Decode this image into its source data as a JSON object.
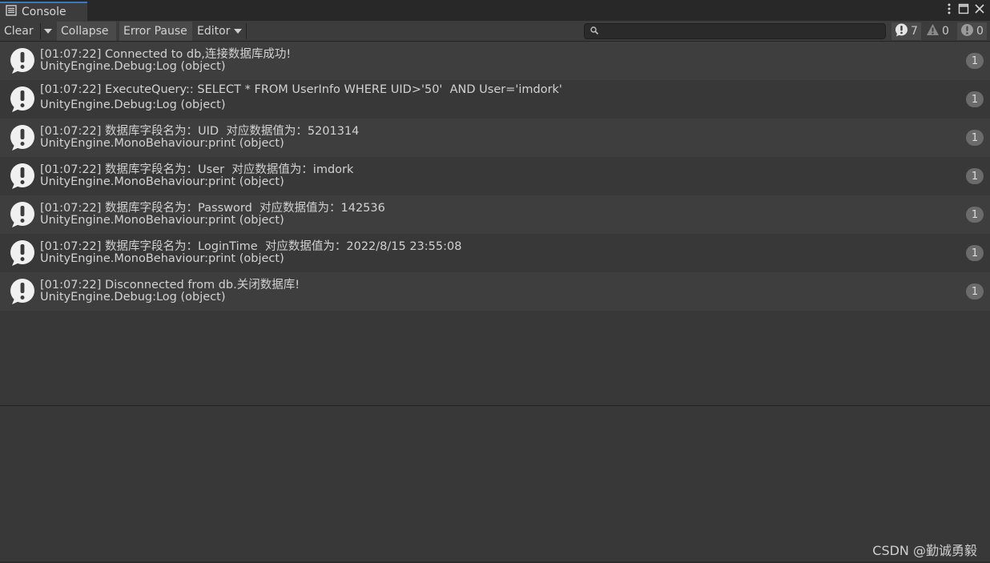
{
  "tab": {
    "title": "Console",
    "icon": "console-list-icon"
  },
  "window_actions": [
    {
      "name": "more-options-icon"
    },
    {
      "name": "maximize-icon"
    },
    {
      "name": "close-icon"
    }
  ],
  "toolbar": {
    "clear_label": "Clear",
    "collapse_label": "Collapse",
    "error_pause_label": "Error Pause",
    "editor_label": "Editor"
  },
  "search": {
    "value": "",
    "placeholder": ""
  },
  "counters": {
    "log": "7",
    "warning": "0",
    "error": "0"
  },
  "colors": {
    "tab_accent": "#3a79bb",
    "row_odd": "#3e3e3e",
    "row_even": "#383838",
    "badge": "#6b6b6b"
  },
  "log_entries": [
    {
      "line1": "[01:07:22] Connected to db,连接数据库成功!",
      "line2": "UnityEngine.Debug:Log (object)",
      "count": "1"
    },
    {
      "line1": "[01:07:22] ExecuteQuery:: SELECT * FROM UserInfo WHERE UID>'50'  AND User='imdork'",
      "line2": "UnityEngine.Debug:Log (object)",
      "count": "1"
    },
    {
      "line1": "[01:07:22] 数据库字段名为：UID  对应数据值为：5201314",
      "line2": "UnityEngine.MonoBehaviour:print (object)",
      "count": "1"
    },
    {
      "line1": "[01:07:22] 数据库字段名为：User  对应数据值为：imdork",
      "line2": "UnityEngine.MonoBehaviour:print (object)",
      "count": "1"
    },
    {
      "line1": "[01:07:22] 数据库字段名为：Password  对应数据值为：142536",
      "line2": "UnityEngine.MonoBehaviour:print (object)",
      "count": "1"
    },
    {
      "line1": "[01:07:22] 数据库字段名为：LoginTime  对应数据值为：2022/8/15 23:55:08",
      "line2": "UnityEngine.MonoBehaviour:print (object)",
      "count": "1"
    },
    {
      "line1": "[01:07:22] Disconnected from db.关闭数据库!",
      "line2": "UnityEngine.Debug:Log (object)",
      "count": "1"
    }
  ],
  "watermark": "CSDN @勤诚勇毅"
}
